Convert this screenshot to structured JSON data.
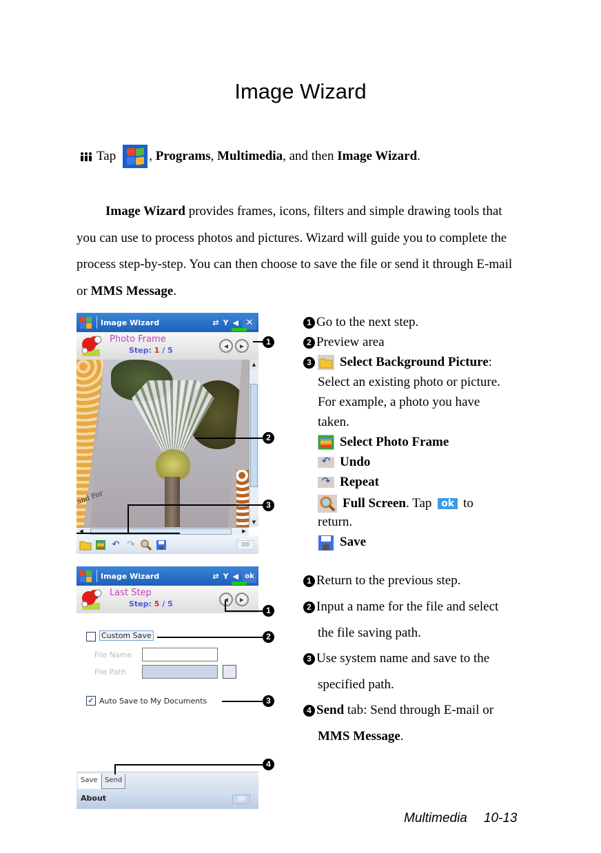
{
  "page": {
    "title": "Image Wizard",
    "tap_line": {
      "tap": "Tap",
      "sep1": ",",
      "programs": "Programs",
      "sep2": ",",
      "multimedia": "Multimedia",
      "and_then": ", and then",
      "image_wizard": "Image Wizard",
      "end": "."
    },
    "intro": {
      "bold_start": "Image Wizard",
      "text": " provides frames, icons, filters and simple drawing tools that you can use to process photos and pictures. Wizard will guide you to complete the process step-by-step. You can then choose to save the file or send it through E-mail or ",
      "bold_end": "MMS Message",
      "end": "."
    },
    "footer": {
      "section": "Multimedia",
      "page_number": "10-13"
    }
  },
  "screen1": {
    "app_title": "Image Wizard",
    "close_glyph": "✕",
    "step_title": "Photo Frame",
    "step_label": "Step:",
    "step_current": "1",
    "step_total": "/ 5",
    "stamp_text": "and For",
    "toolbar_icons": [
      "folder-icon",
      "photo-frame-icon",
      "undo-icon",
      "redo-icon",
      "magnifier-icon",
      "save-disk-icon"
    ]
  },
  "screen1_notes": {
    "items": [
      {
        "num": "1",
        "text": "Go to the next step."
      },
      {
        "num": "2",
        "text": "Preview area"
      },
      {
        "num": "3",
        "bold": "Select Background Picture",
        "suffix": ":",
        "lines": [
          "Select an existing photo or picture.",
          "For example, a photo you have",
          "taken."
        ]
      }
    ],
    "tools": [
      {
        "icon": "photo-frame-icon",
        "label": "Select Photo Frame"
      },
      {
        "icon": "undo-icon",
        "label": "Undo"
      },
      {
        "icon": "repeat-icon",
        "label": "Repeat"
      },
      {
        "icon": "magnifier-icon",
        "label": "Full Screen",
        "after": ". Tap",
        "ok": "ok",
        "to": "to",
        "line2": "return."
      },
      {
        "icon": "save-disk-icon",
        "label": "Save"
      }
    ]
  },
  "screen2": {
    "app_title": "Image Wizard",
    "ok_button": "ok",
    "step_title": "Last Step",
    "step_label": "Step:",
    "step_current": "5",
    "step_total": "/ 5",
    "custom_save_label": "Custom Save",
    "custom_save_checked": false,
    "file_name_label": "File Name",
    "file_path_label": "File Path",
    "file_name_value": "",
    "file_path_value": "",
    "auto_save_label": "Auto Save to My Documents",
    "auto_save_checked": true,
    "tabs": [
      "Save",
      "Send"
    ],
    "menu": "About"
  },
  "screen2_notes": {
    "items": [
      {
        "num": "1",
        "lines": [
          "Return to the previous step."
        ]
      },
      {
        "num": "2",
        "lines": [
          "Input a name for the file and select",
          "the file saving path."
        ]
      },
      {
        "num": "3",
        "lines": [
          "Use system name and save to the",
          "specified path."
        ]
      },
      {
        "num": "4",
        "bold": "Send",
        "rest": " tab: Send through E-mail or",
        "line2_bold": "MMS Message",
        "line2_end": "."
      }
    ]
  },
  "callouts": {
    "screen1": [
      "1",
      "2",
      "3"
    ],
    "screen2": [
      "1",
      "2",
      "3",
      "4"
    ]
  }
}
